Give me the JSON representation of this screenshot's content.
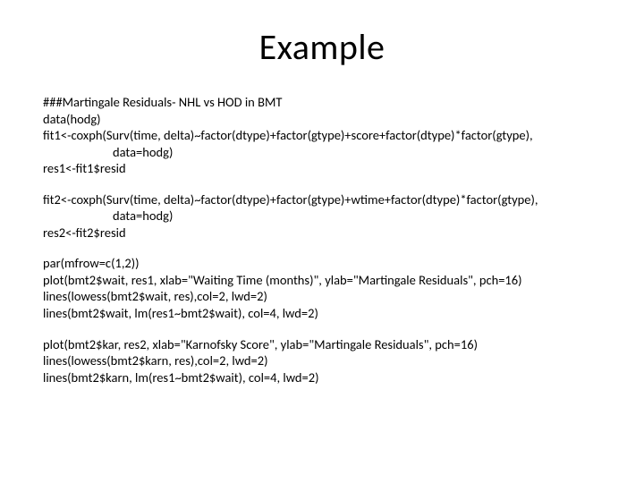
{
  "title": "Example",
  "block1": {
    "l1": "###Martingale Residuals- NHL vs HOD in BMT",
    "l2": "data(hodg)",
    "l3": "fit1<-coxph(Surv(time, delta)~factor(dtype)+factor(gtype)+score+factor(dtype)*factor(gtype),",
    "l4": "data=hodg)",
    "l5": "res1<-fit1$resid"
  },
  "block2": {
    "l1": "fit2<-coxph(Surv(time, delta)~factor(dtype)+factor(gtype)+wtime+factor(dtype)*factor(gtype),",
    "l2": "data=hodg)",
    "l3": "res2<-fit2$resid"
  },
  "block3": {
    "l1": "par(mfrow=c(1,2))",
    "l2": "plot(bmt2$wait, res1, xlab=\"Waiting Time (months)\", ylab=\"Martingale Residuals\", pch=16)",
    "l3": "lines(lowess(bmt2$wait, res),col=2, lwd=2)",
    "l4": "lines(bmt2$wait, lm(res1~bmt2$wait), col=4, lwd=2)"
  },
  "block4": {
    "l1": "plot(bmt2$kar, res2, xlab=\"Karnofsky Score\", ylab=\"Martingale Residuals\", pch=16)",
    "l2": "lines(lowess(bmt2$karn, res),col=2, lwd=2)",
    "l3": "lines(bmt2$karn, lm(res1~bmt2$wait), col=4, lwd=2)"
  }
}
